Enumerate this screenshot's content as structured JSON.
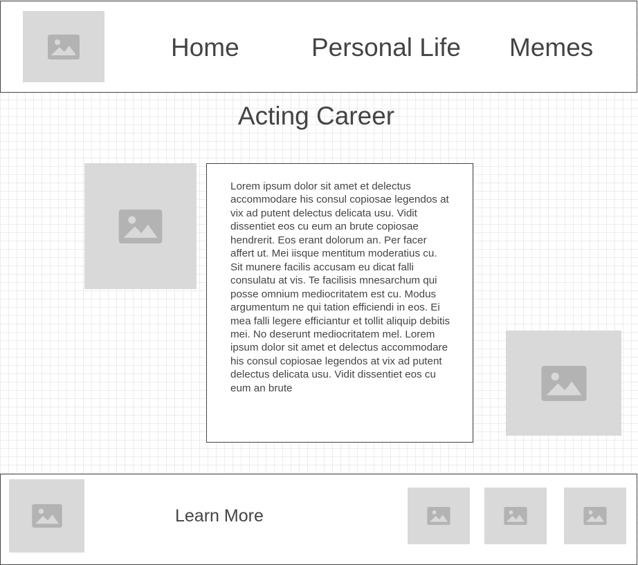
{
  "header": {
    "logo_icon": "image-placeholder-icon",
    "nav": [
      {
        "label": "Home"
      },
      {
        "label": "Personal Life"
      },
      {
        "label": "Memes"
      }
    ]
  },
  "main": {
    "title": "Acting Career",
    "body_text": "Lorem ipsum dolor sit amet et delectus accommodare his consul copiosae legendos at vix ad putent delectus delicata usu. Vidit dissentiet eos cu eum an brute copiosae hendrerit. Eos erant dolorum an. Per facer affert ut. Mei iisque mentitum moderatius cu. Sit munere facilis accusam eu dicat falli consulatu at vis. Te facilisis mnesarchum qui posse omnium mediocritatem est cu. Modus argumentum ne qui tation efficiendi in eos. Ei mea falli legere efficiantur et tollit aliquip debitis mei. No deserunt mediocritatem mel. Lorem ipsum dolor sit amet et delectus accommodare his consul copiosae legendos at vix ad putent delectus delicata usu. Vidit dissentiet eos cu eum an brute",
    "image_icon": "image-placeholder-icon"
  },
  "footer": {
    "learn_more": "Learn More",
    "image_icon": "image-placeholder-icon"
  },
  "colors": {
    "placeholder_bg": "#d9d9d9",
    "placeholder_icon": "#b3b3b3",
    "text": "#444444",
    "border": "#444444",
    "grid": "#ececec"
  }
}
